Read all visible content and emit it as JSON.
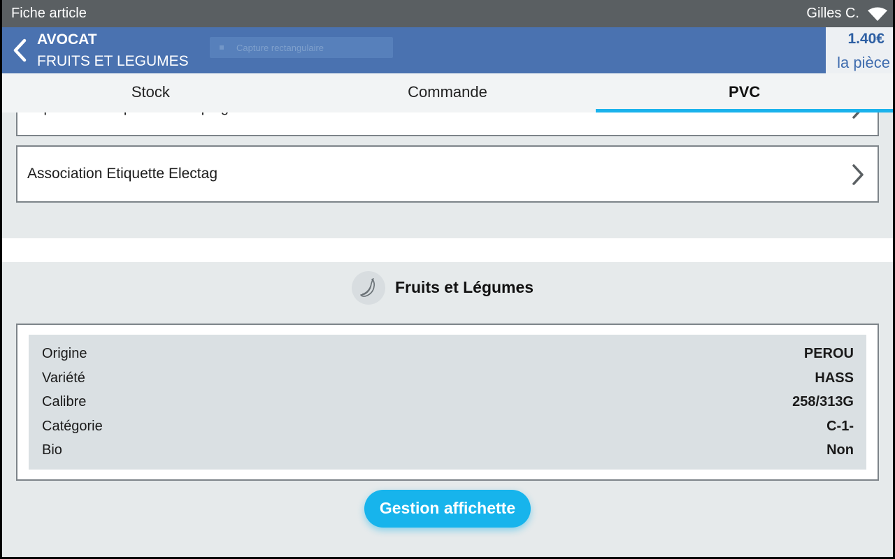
{
  "statusbar": {
    "title": "Fiche article",
    "user": "Gilles C.",
    "wifi_icon": "wifi-icon"
  },
  "header": {
    "product_name": "AVOCAT",
    "product_family": "FRUITS ET LEGUMES",
    "price": "1.40€",
    "price_unit": "la pièce",
    "ghost_text": "Capture rectangulaire",
    "back_icon": "chevron-left-icon"
  },
  "tabs": [
    {
      "label": "Stock",
      "active": false
    },
    {
      "label": "Commande",
      "active": false
    },
    {
      "label": "PVC",
      "active": true
    }
  ],
  "menu_rows": [
    {
      "label": "Impression étiquettes marquage"
    },
    {
      "label": "Association Etiquette Electag"
    }
  ],
  "section": {
    "title": "Fruits et Légumes",
    "icon": "banana-icon"
  },
  "attributes": [
    {
      "key": "Origine",
      "value": "PEROU"
    },
    {
      "key": "Variété",
      "value": "HASS"
    },
    {
      "key": "Calibre",
      "value": "258/313G"
    },
    {
      "key": "Catégorie",
      "value": "C-1-"
    },
    {
      "key": "Bio",
      "value": "Non"
    }
  ],
  "action_button": {
    "label": "Gestion affichette"
  },
  "colors": {
    "header": "#4a72b0",
    "statusbar": "#5a5f62",
    "accent": "#17b4ec"
  }
}
